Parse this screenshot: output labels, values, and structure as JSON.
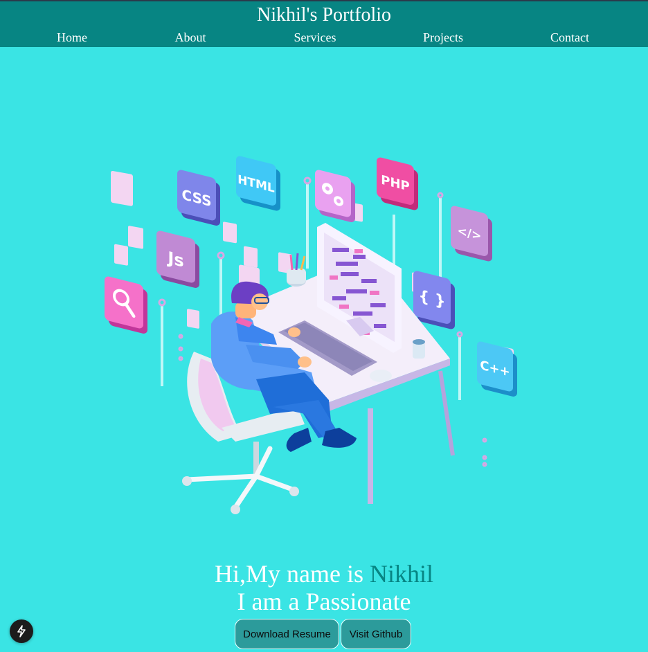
{
  "header": {
    "title": "Nikhil's Portfolio",
    "nav": [
      "Home",
      "About",
      "Services",
      "Projects",
      "Contact"
    ]
  },
  "illustration": {
    "tiles": [
      "CSS",
      "HTML",
      "PHP",
      "Js",
      "</>",
      "{ }",
      "C++"
    ]
  },
  "hero": {
    "greeting": "Hi,My name is",
    "name": "Nikhil",
    "tagline": "I am a Passionate"
  },
  "actions": {
    "resume": "Download Resume",
    "github": "Visit Github"
  },
  "colors": {
    "background": "#3ae4e4",
    "header": "#078583",
    "accent_name": "#078583",
    "button": "#2c9b9b"
  },
  "icons": {
    "floating_badge": "lightning-bolt-icon"
  }
}
